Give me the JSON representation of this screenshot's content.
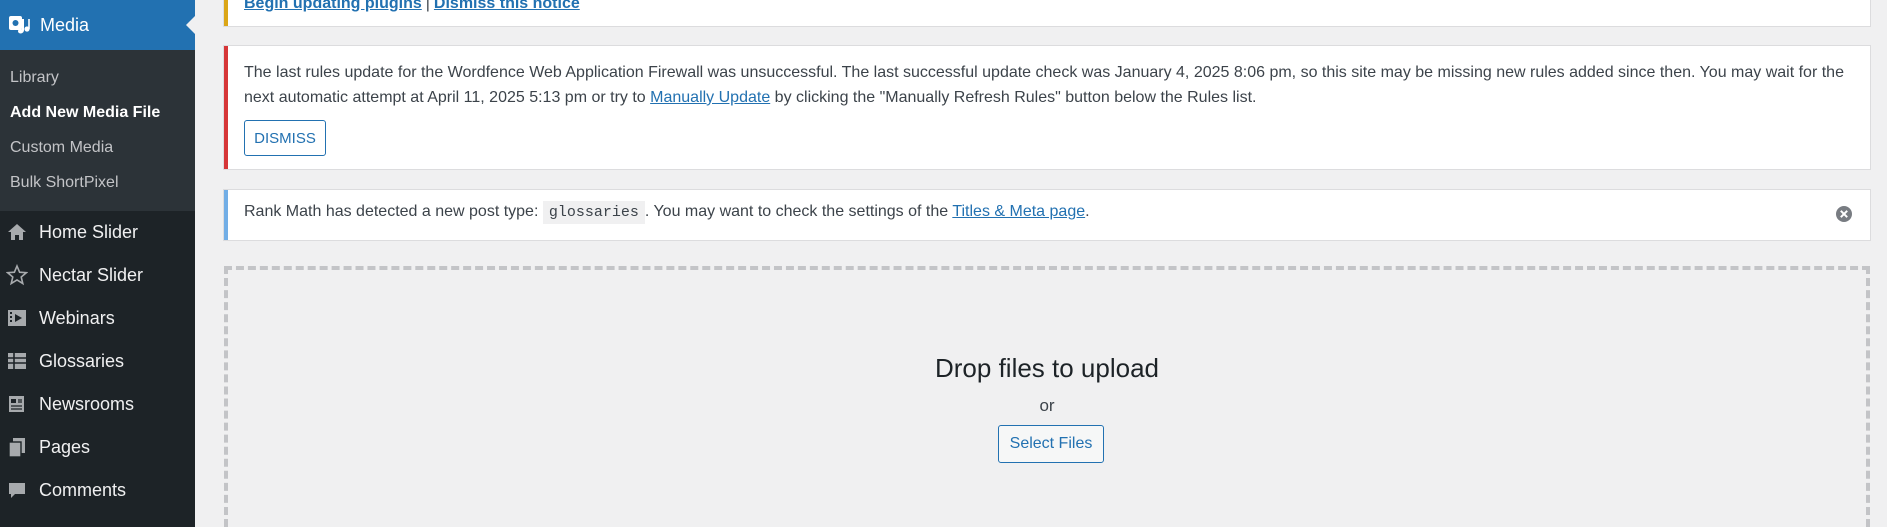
{
  "sidebar": {
    "media_label": "Media",
    "media_icon": "media-icon",
    "submenu": [
      {
        "label": "Library",
        "current": false
      },
      {
        "label": "Add New Media File",
        "current": true
      },
      {
        "label": "Custom Media",
        "current": false
      },
      {
        "label": "Bulk ShortPixel",
        "current": false
      }
    ],
    "menu": [
      {
        "label": "Home Slider",
        "icon": "home-icon"
      },
      {
        "label": "Nectar Slider",
        "icon": "star-icon"
      },
      {
        "label": "Webinars",
        "icon": "video-icon"
      },
      {
        "label": "Glossaries",
        "icon": "table-icon"
      },
      {
        "label": "Newsrooms",
        "icon": "news-icon"
      },
      {
        "label": "Pages",
        "icon": "pages-icon"
      },
      {
        "label": "Comments",
        "icon": "comment-icon"
      }
    ]
  },
  "notices": {
    "update": {
      "begin_link": "Begin updating plugins",
      "separator": "|",
      "dismiss_link": "Dismiss this notice"
    },
    "waf": {
      "text_before_link": "The last rules update for the Wordfence Web Application Firewall was unsuccessful. The last successful update check was January 4, 2025 8:06 pm, so this site may be missing new rules added since then. You may wait for the next automatic attempt at April 11, 2025 5:13 pm or try to ",
      "link": "Manually Update",
      "text_after_link": " by clicking the \"Manually Refresh Rules\" button below the Rules list.",
      "dismiss_button": "DISMISS"
    },
    "rank_math": {
      "text_before_code": "Rank Math has detected a new post type: ",
      "code": "glossaries",
      "text_middle": ". You may want to check the settings of the ",
      "link": "Titles & Meta page",
      "text_end": "."
    }
  },
  "uploader": {
    "title": "Drop files to upload",
    "or": "or",
    "button": "Select Files"
  },
  "colors": {
    "sidebar_bg": "#1d2327",
    "submenu_bg": "#2c3338",
    "accent": "#2271b1",
    "warning": "#dba617",
    "error": "#d63638",
    "info": "#72aee6"
  }
}
